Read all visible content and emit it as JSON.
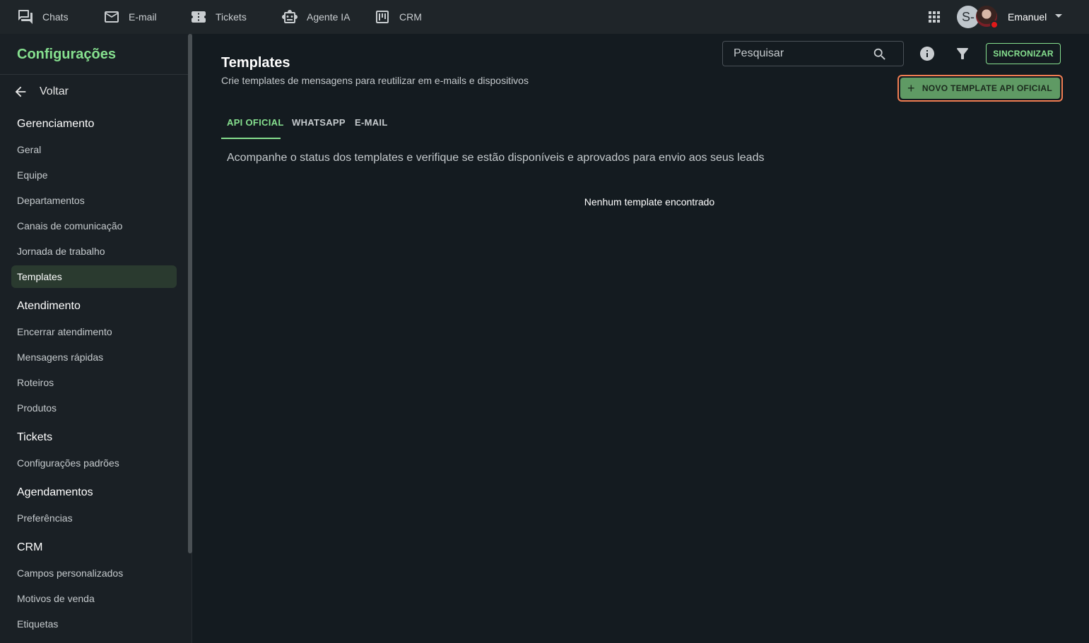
{
  "topnav": {
    "items": [
      {
        "label": "Chats",
        "icon": "chat-icon"
      },
      {
        "label": "E-mail",
        "icon": "mail-icon"
      },
      {
        "label": "Tickets",
        "icon": "ticket-icon"
      },
      {
        "label": "Agente IA",
        "icon": "robot-icon"
      },
      {
        "label": "CRM",
        "icon": "kanban-icon"
      }
    ],
    "avatar_initial": "S-",
    "user_name": "Emanuel"
  },
  "sidebar": {
    "title": "Configurações",
    "back_label": "Voltar",
    "groups": [
      {
        "heading": "Gerenciamento",
        "items": [
          "Geral",
          "Equipe",
          "Departamentos",
          "Canais de comunicação",
          "Jornada de trabalho",
          "Templates"
        ]
      },
      {
        "heading": "Atendimento",
        "items": [
          "Encerrar atendimento",
          "Mensagens rápidas",
          "Roteiros",
          "Produtos"
        ]
      },
      {
        "heading": "Tickets",
        "items": [
          "Configurações padrões"
        ]
      },
      {
        "heading": "Agendamentos",
        "items": [
          "Preferências"
        ]
      },
      {
        "heading": "CRM",
        "items": [
          "Campos personalizados",
          "Motivos de venda",
          "Etiquetas"
        ]
      }
    ],
    "active_item": "Templates"
  },
  "main": {
    "title": "Templates",
    "subtitle": "Crie templates de mensagens para reutilizar em e-mails e dispositivos",
    "search_placeholder": "Pesquisar",
    "sync_label": "SINCRONIZAR",
    "new_template_label": "NOVO TEMPLATE API OFICIAL",
    "tabs": [
      "API OFICIAL",
      "WHATSAPP",
      "E-MAIL"
    ],
    "active_tab": "API OFICIAL",
    "status_text": "Acompanhe o status dos templates e verifique se estão disponíveis e aprovados para envio aos seus leads",
    "empty_text": "Nenhum template encontrado"
  },
  "colors": {
    "accent": "#86e08f",
    "button_fill": "#5f9a64",
    "highlight_outline": "#f07d52",
    "background": "#141b20"
  }
}
